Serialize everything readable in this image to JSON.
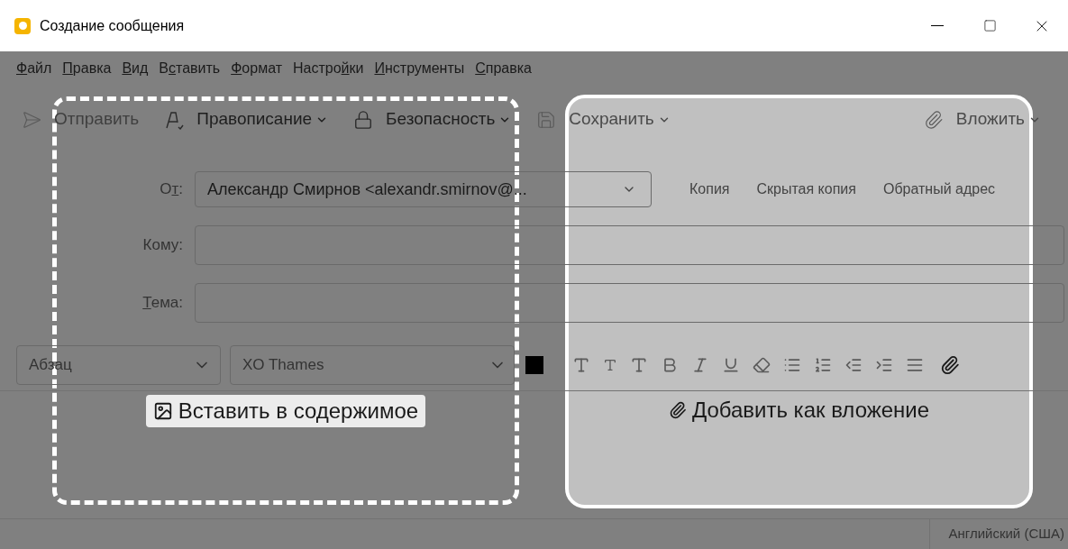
{
  "window": {
    "title": "Создание сообщения"
  },
  "menu": [
    {
      "key": "Ф",
      "post": "айл"
    },
    {
      "key": "П",
      "post": "равка"
    },
    {
      "key": "В",
      "post": "ид"
    },
    {
      "pre": "В",
      "key": "с",
      "post": "тавить"
    },
    {
      "key": "Ф",
      "post": "ормат"
    },
    {
      "pre": "Настро",
      "key": "й",
      "post": "ки"
    },
    {
      "key": "И",
      "post": "нструменты"
    },
    {
      "key": "С",
      "post": "правка"
    }
  ],
  "toolbar": [
    {
      "kind": "send",
      "label": "Отправить",
      "disabled": true,
      "dropdown": false
    },
    {
      "kind": "spelling",
      "label": "Правописание",
      "disabled": false,
      "dropdown": true
    },
    {
      "kind": "security",
      "label": "Безопасность",
      "disabled": false,
      "dropdown": true
    },
    {
      "kind": "save",
      "label": "Сохранить",
      "disabled": false,
      "dropdown": true
    },
    {
      "kind": "attach",
      "label": "Вложить",
      "disabled": false,
      "dropdown": true
    }
  ],
  "header": {
    "from": {
      "pre": "О",
      "key": "т",
      "post": ":",
      "value": "Александр Смирнов <alexandr.smirnov@..."
    },
    "to": {
      "pre": "Кому:"
    },
    "subject": {
      "key": "Т",
      "post": "ема:"
    },
    "extra_recipients": [
      "Копия",
      "Скрытая копия",
      "Обратный адрес"
    ]
  },
  "format": {
    "paragraph": "Абзац",
    "font": "XO Thames"
  },
  "drop_zones": {
    "inline": {
      "label": "Вставить в содержимое"
    },
    "attachment": {
      "label": "Добавить как вложение"
    }
  },
  "status_bar": {
    "language": "Английский (США)"
  }
}
